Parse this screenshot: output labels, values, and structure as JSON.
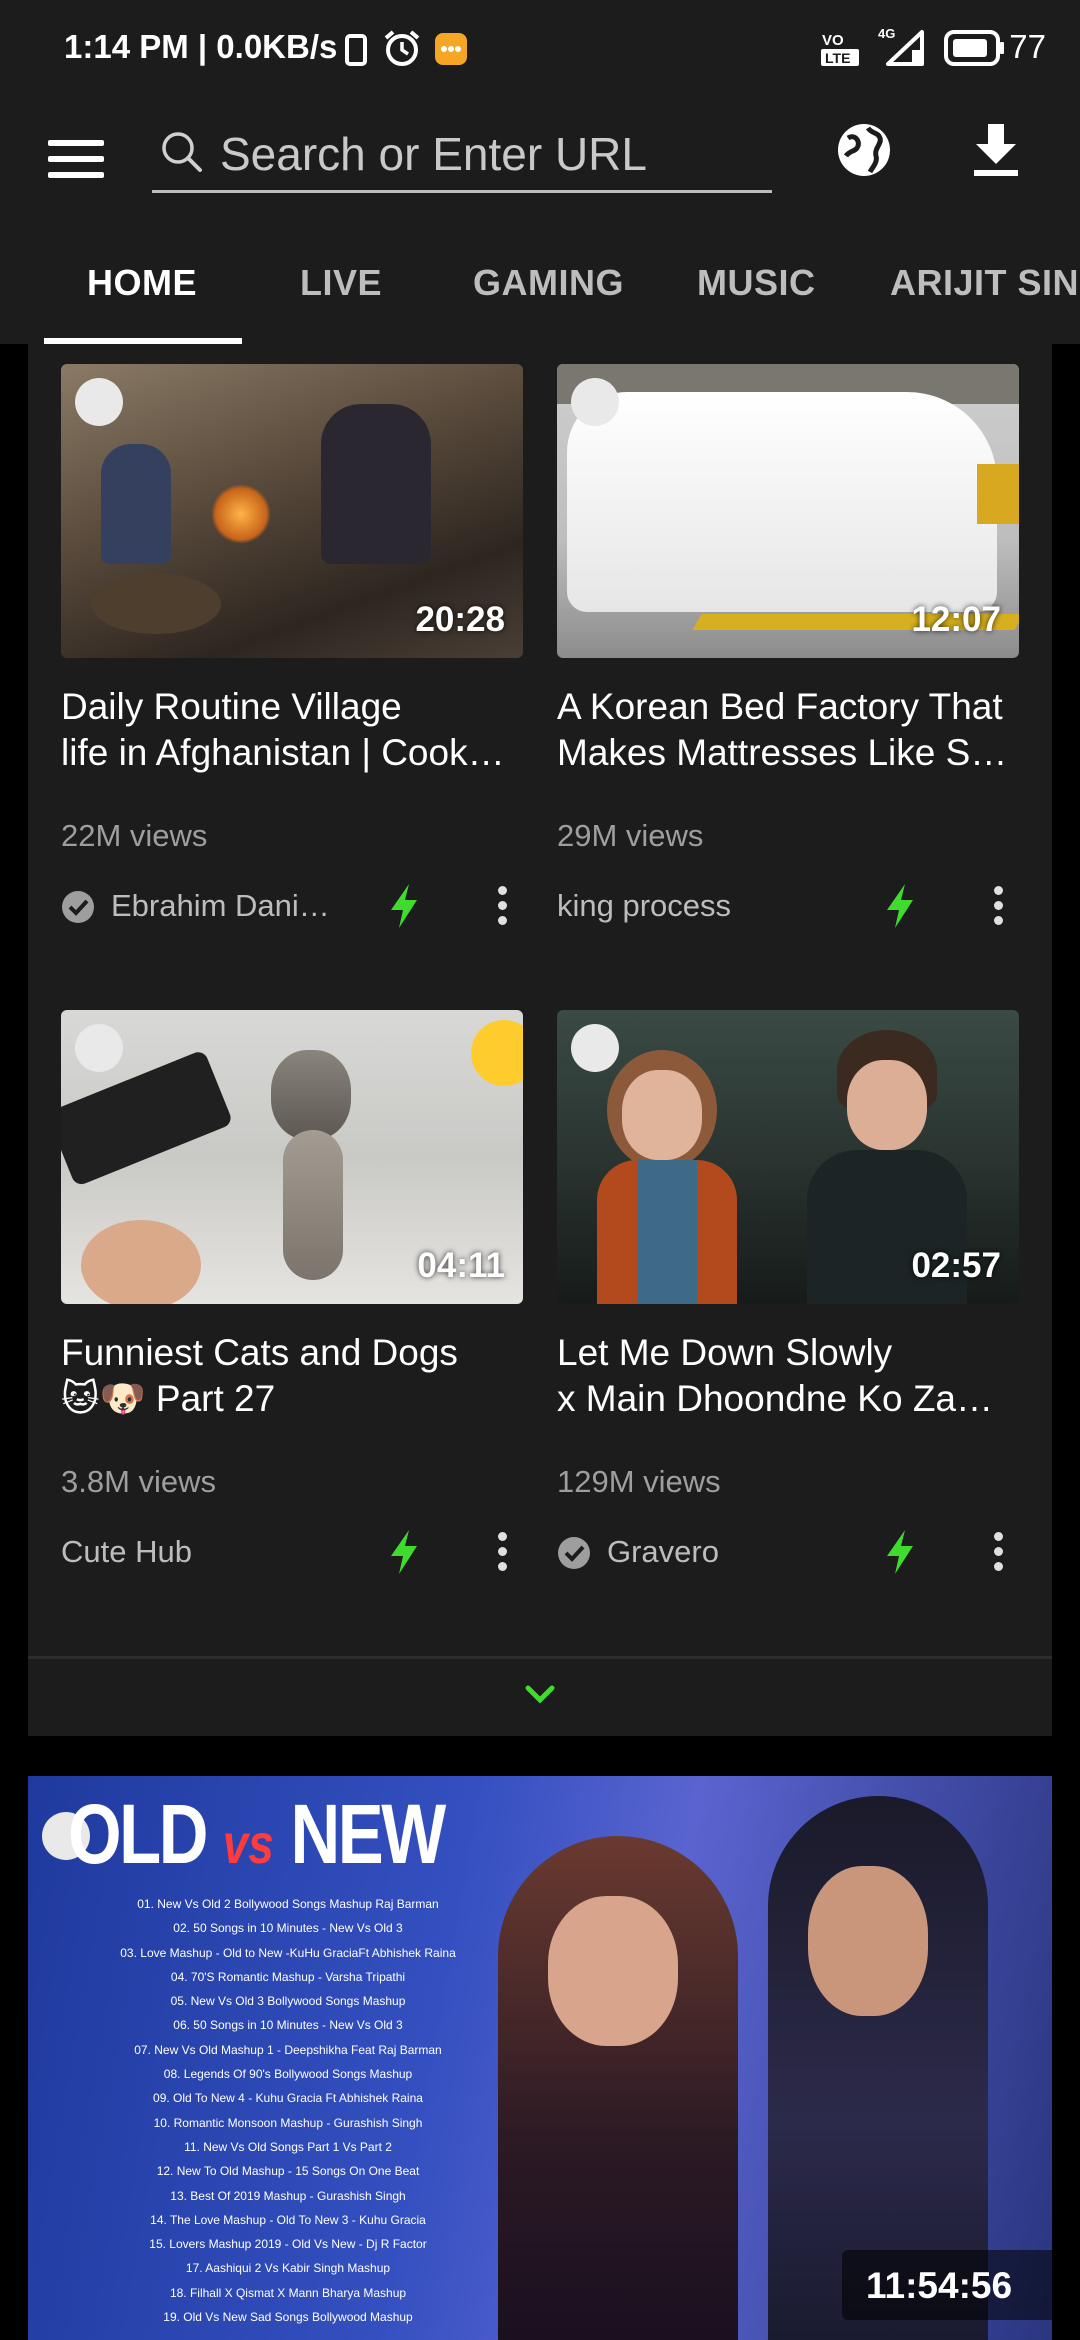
{
  "status_bar": {
    "time": "1:14 PM",
    "speed": "0.0KB/s",
    "network": "4G",
    "volte": "LTE",
    "battery": "77"
  },
  "toolbar": {
    "search_placeholder": "Search or Enter URL"
  },
  "tabs": [
    {
      "label": "HOME",
      "active": true
    },
    {
      "label": "LIVE",
      "active": false
    },
    {
      "label": "GAMING",
      "active": false
    },
    {
      "label": "MUSIC",
      "active": false
    },
    {
      "label": "ARIJIT SIN",
      "active": false
    }
  ],
  "videos": [
    {
      "title_line1": "Daily Routine Village",
      "title_line2": "life in Afghanistan | Cook…",
      "views": "22M views",
      "channel": "Ebrahim Dani…",
      "verified": true,
      "duration": "20:28"
    },
    {
      "title_line1": "A Korean Bed Factory That",
      "title_line2": "Makes Mattresses Like S…",
      "views": "29M views",
      "channel": "king process",
      "verified": false,
      "duration": "12:07"
    },
    {
      "title_line1": "Funniest Cats and Dogs",
      "title_line2": "🐱🐶 Part 27",
      "views": "3.8M views",
      "channel": "Cute Hub",
      "verified": false,
      "duration": "04:11"
    },
    {
      "title_line1": "Let Me Down Slowly",
      "title_line2": "x Main Dhoondne Ko Za…",
      "views": "129M views",
      "channel": "Gravero",
      "verified": true,
      "duration": "02:57"
    }
  ],
  "featured": {
    "title_old": "OLD",
    "title_vs": "vs",
    "title_new": "NEW",
    "duration": "11:54:56",
    "tracklist": [
      "01. New Vs Old 2 Bollywood Songs Mashup Raj Barman",
      "02. 50 Songs in 10 Minutes - New Vs Old 3",
      "03. Love Mashup - Old to New -KuHu GraciaFt Abhishek Raina",
      "04. 70'S Romantic Mashup - Varsha Tripathi",
      "05. New Vs Old 3 Bollywood Songs Mashup",
      "06. 50 Songs in 10 Minutes - New Vs Old 3",
      "07. New Vs Old Mashup 1 - Deepshikha Feat Raj Barman",
      "08. Legends Of 90's Bollywood Songs Mashup",
      "09. Old To New 4 - Kuhu Gracia Ft Abhishek Raina",
      "10. Romantic Monsoon Mashup - Gurashish Singh",
      "11. New Vs Old Songs Part 1 Vs Part 2",
      "12. New To Old Mashup - 15 Songs On One Beat",
      "13. Best Of 2019 Mashup - Gurashish Singh",
      "14. The Love Mashup - Old To New 3 - Kuhu Gracia",
      "15. Lovers Mashup 2019 - Old Vs New - Dj R Factor",
      "17. Aashiqui 2 Vs Kabir Singh Mashup",
      "18. Filhall X Qismat X Mann Bharya Mashup",
      "19. Old Vs New Sad Songs Bollywood Mashup"
    ]
  },
  "colors": {
    "background": "#000000",
    "surface": "#1c1c1c",
    "accent_green": "#3fdc2e",
    "text_secondary": "#9e9e9e"
  }
}
